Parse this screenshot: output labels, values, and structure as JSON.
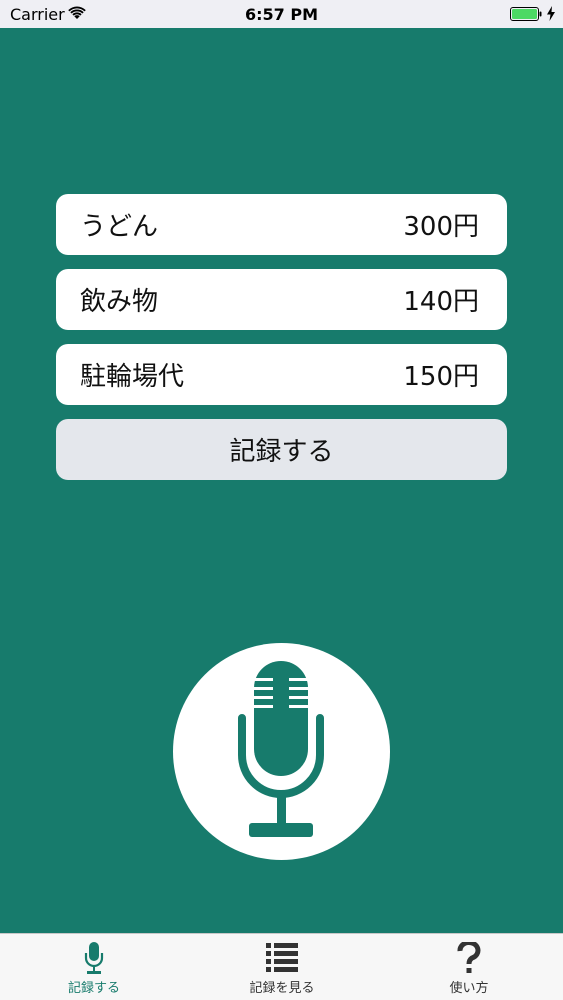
{
  "status_bar": {
    "carrier": "Carrier",
    "time": "6:57 PM",
    "wifi_icon": "wifi-icon",
    "battery_icon": "battery-icon",
    "charging_icon": "charging-bolt-icon",
    "battery_color": "#4cd964"
  },
  "items": [
    {
      "name": "うどん",
      "price": "300円"
    },
    {
      "name": "飲み物",
      "price": "140円"
    },
    {
      "name": "駐輪場代",
      "price": "150円"
    }
  ],
  "record_button": {
    "label": "記録する"
  },
  "mic_button": {
    "icon": "microphone-icon"
  },
  "tabs": [
    {
      "label": "記録する",
      "icon": "microphone-icon",
      "active": true
    },
    {
      "label": "記録を見る",
      "icon": "list-icon",
      "active": false
    },
    {
      "label": "使い方",
      "icon": "question-mark-icon",
      "active": false
    }
  ],
  "colors": {
    "background": "#177b6c",
    "accent": "#177b6c",
    "tab_inactive": "#333333",
    "button_background": "#e4e7ec"
  }
}
